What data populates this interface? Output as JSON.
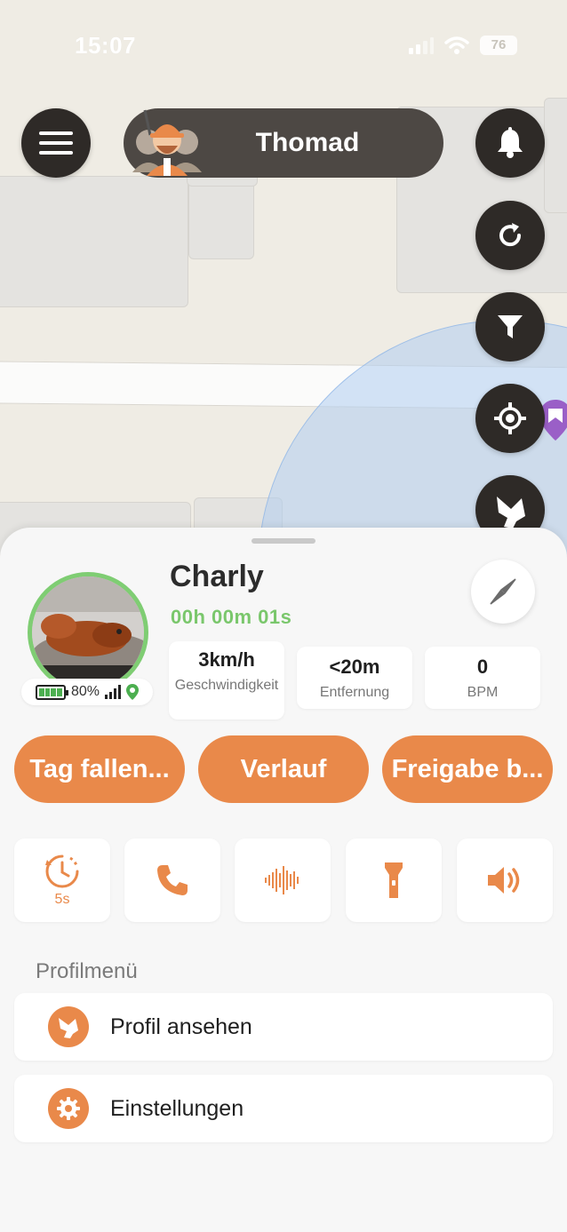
{
  "status_bar": {
    "time": "15:07",
    "battery": "76"
  },
  "header": {
    "user_name": "Thomad"
  },
  "dog": {
    "name": "Charly",
    "timer": "00h 00m 01s",
    "battery": "80%"
  },
  "stats": [
    {
      "value": "3km/h",
      "label": "Geschwindigkeit"
    },
    {
      "value": "<20m",
      "label": "Entfernung"
    },
    {
      "value": "0",
      "label": "BPM"
    }
  ],
  "pills": {
    "drop": "Tag fallen...",
    "history": "Verlauf",
    "share": "Freigabe b..."
  },
  "actions": {
    "timer_value": "5s"
  },
  "profile_menu": {
    "title": "Profilmenü",
    "items": [
      {
        "label": "Profil ansehen",
        "icon": "dog-head-icon"
      },
      {
        "label": "Einstellungen",
        "icon": "gear-icon"
      }
    ]
  },
  "colors": {
    "accent": "#e9894a",
    "success": "#7ac76c",
    "dark_button": "#2e2a27"
  }
}
